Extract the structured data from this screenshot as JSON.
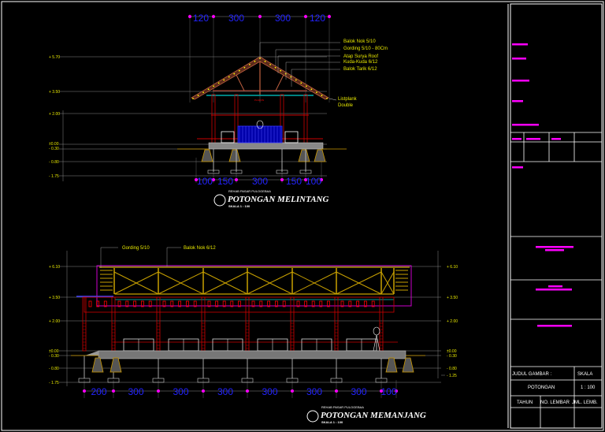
{
  "section_cross": {
    "title": "POTONGAN MELINTANG",
    "project": "REHAB PASAR PULOGEBAA",
    "scale": "SKALA 1 : 100",
    "dims_top": [
      "120",
      "300",
      "300",
      "120"
    ],
    "dims_bottom": [
      "100",
      "150",
      "300",
      "150",
      "100"
    ],
    "levels": [
      "+ 5.70",
      "+ 3.50",
      "+ 2.00",
      "±0.00",
      "- 0.30",
      "- 0.80",
      "- 1.75"
    ],
    "annotations": [
      "Balok Nok 5/10",
      "Gording 5/10 - 80Cm",
      "Atap Surya Roof",
      "Kuda-Kuda 6/12",
      "Balok Tarik 6/12",
      "Listplank",
      "Double"
    ]
  },
  "section_long": {
    "title": "POTONGAN MEMANJANG",
    "project": "REHAB PASAR PULOGEBAA",
    "scale": "SKALA 1 : 100",
    "dims": [
      "200",
      "300",
      "300",
      "300",
      "300",
      "300",
      "300",
      "100"
    ],
    "levels_left": [
      "+ 6.10",
      "+ 3.50",
      "+ 2.00",
      "±0.00",
      "- 0.30",
      "- 0.80",
      "- 1.75"
    ],
    "levels_right": [
      "+ 6.10",
      "+ 3.50",
      "+ 2.00",
      "±0.00",
      "- 0.30",
      "- 0.80",
      "- 1.25"
    ],
    "annotations": [
      "Gording 5/10",
      "Balok Nok 6/12"
    ]
  },
  "title_block": {
    "drawing_title_label": "JUDUL GAMBAR :",
    "scale_label": "SKALA",
    "drawing_title": "POTONGAN",
    "scale_value": "1 : 100",
    "year_label": "TAHUN",
    "sheet_no_label": "NO. LEMBAR",
    "sheet_count_label": "JML. LEMB."
  },
  "colors": {
    "background": "#000000",
    "dimension": "#2323ff",
    "level_text": "#e8e800",
    "structure": "#c00000",
    "truss": "#c8a000",
    "placeholder": "#ff00ff"
  }
}
